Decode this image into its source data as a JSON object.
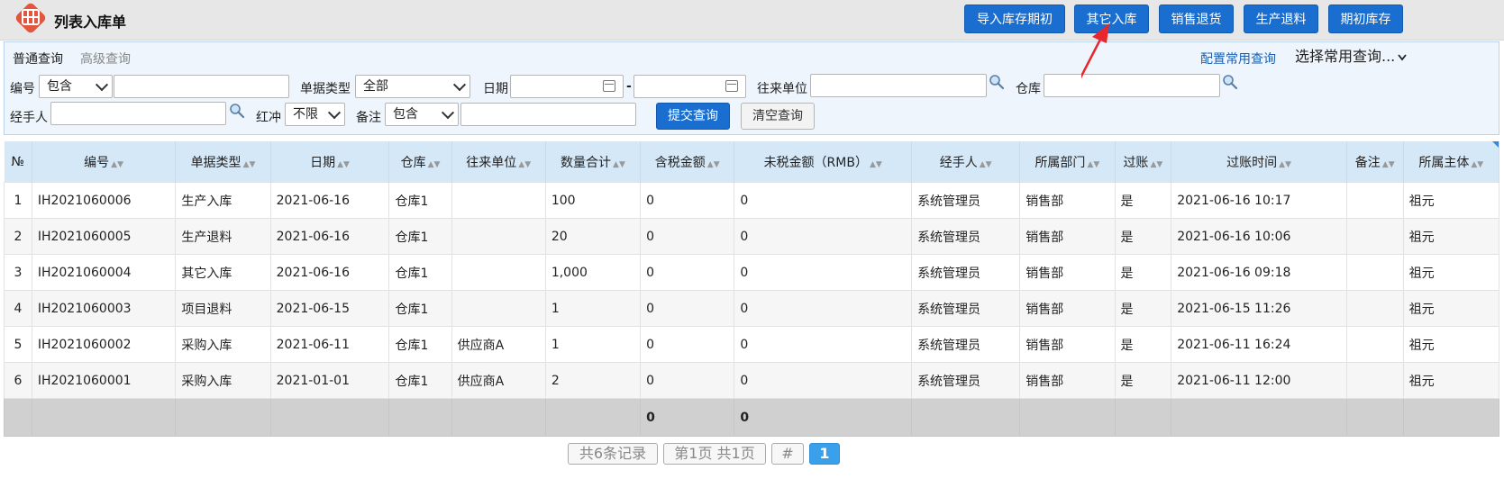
{
  "header": {
    "title": "列表入库单",
    "buttons": [
      "导入库存期初",
      "其它入库",
      "销售退货",
      "生产退料",
      "期初库存"
    ]
  },
  "filter": {
    "tab_normal": "普通查询",
    "tab_advanced": "高级查询",
    "config_link": "配置常用查询",
    "common_query_select": "选择常用查询...",
    "code_label": "编号",
    "code_op": "包含",
    "code_value": "",
    "type_label": "单据类型",
    "type_value": "全部",
    "date_label": "日期",
    "date_from": "",
    "date_sep": "-",
    "date_to": "",
    "partner_label": "往来单位",
    "partner_value": "",
    "warehouse_label": "仓库",
    "warehouse_value": "",
    "handler_label": "经手人",
    "handler_value": "",
    "redflush_label": "红冲",
    "redflush_value": "不限",
    "remark_label": "备注",
    "remark_op": "包含",
    "remark_value": "",
    "submit": "提交查询",
    "clear": "清空查询"
  },
  "table": {
    "columns": [
      "№",
      "编号",
      "单据类型",
      "日期",
      "仓库",
      "往来单位",
      "数量合计",
      "含税金额",
      "未税金额（RMB）",
      "经手人",
      "所属部门",
      "过账",
      "过账时间",
      "备注",
      "所属主体"
    ],
    "rows": [
      [
        "1",
        "IH2021060006",
        "生产入库",
        "2021-06-16",
        "仓库1",
        "",
        "100",
        "0",
        "0",
        "系统管理员",
        "销售部",
        "是",
        "2021-06-16 10:17",
        "",
        "祖元"
      ],
      [
        "2",
        "IH2021060005",
        "生产退料",
        "2021-06-16",
        "仓库1",
        "",
        "20",
        "0",
        "0",
        "系统管理员",
        "销售部",
        "是",
        "2021-06-16 10:06",
        "",
        "祖元"
      ],
      [
        "3",
        "IH2021060004",
        "其它入库",
        "2021-06-16",
        "仓库1",
        "",
        "1,000",
        "0",
        "0",
        "系统管理员",
        "销售部",
        "是",
        "2021-06-16 09:18",
        "",
        "祖元"
      ],
      [
        "4",
        "IH2021060003",
        "项目退料",
        "2021-06-15",
        "仓库1",
        "",
        "1",
        "0",
        "0",
        "系统管理员",
        "销售部",
        "是",
        "2021-06-15 11:26",
        "",
        "祖元"
      ],
      [
        "5",
        "IH2021060002",
        "采购入库",
        "2021-06-11",
        "仓库1",
        "供应商A",
        "1",
        "0",
        "0",
        "系统管理员",
        "销售部",
        "是",
        "2021-06-11 16:24",
        "",
        "祖元"
      ],
      [
        "6",
        "IH2021060001",
        "采购入库",
        "2021-01-01",
        "仓库1",
        "供应商A",
        "2",
        "0",
        "0",
        "系统管理员",
        "销售部",
        "是",
        "2021-06-11 12:00",
        "",
        "祖元"
      ]
    ],
    "summary": [
      "",
      "",
      "",
      "",
      "",
      "",
      "",
      "0",
      "0",
      "",
      "",
      "",
      "",
      "",
      ""
    ]
  },
  "pagination": {
    "total_records": "共6条记录",
    "page_info": "第1页 共1页",
    "goto": "#",
    "current": "1"
  },
  "colors": {
    "primary": "#1a6ed0",
    "header_bg": "#e7e7e7",
    "filter_bg": "#eef5fd",
    "table_head": "#d5e8f8",
    "summary_row": "#d0d0d0",
    "page_active": "#3aa0ec",
    "logo": "#e2563f",
    "annotation_arrow": "#e8262b"
  }
}
